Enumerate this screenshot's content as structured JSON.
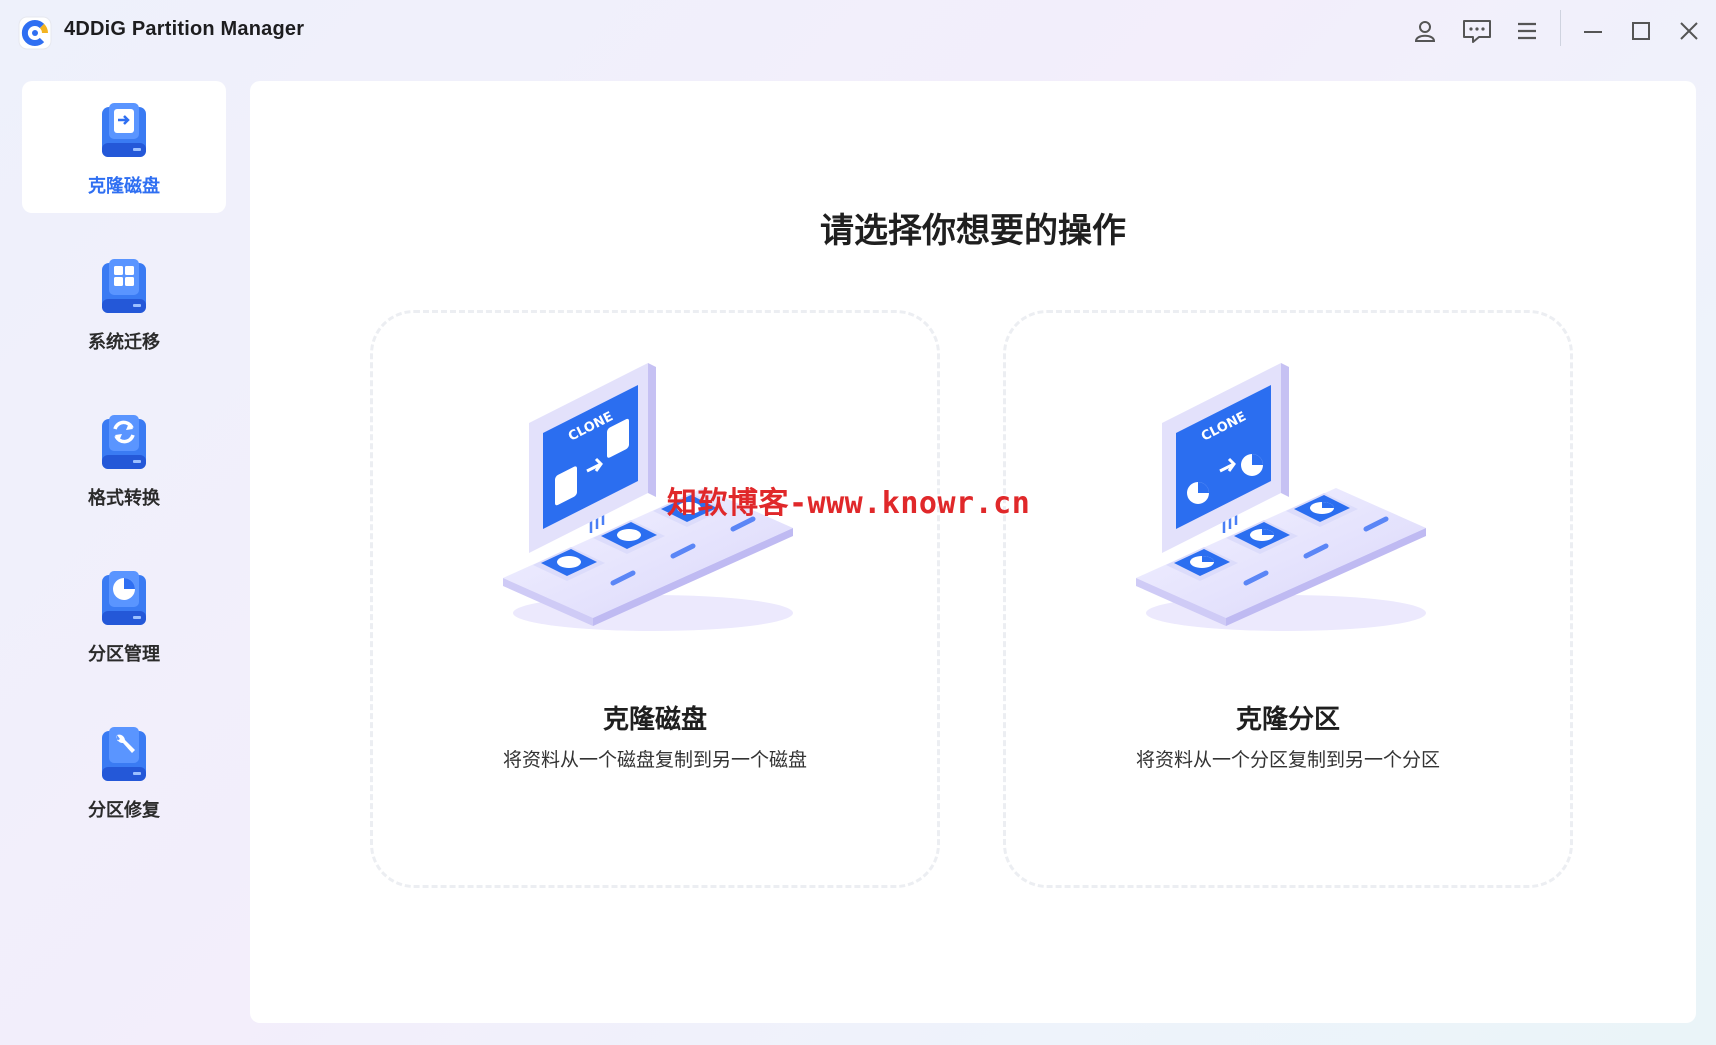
{
  "app": {
    "title": "4DDiG Partition Manager",
    "logo_icon": "4ddig-logo-icon"
  },
  "titlebar": {
    "buttons": [
      {
        "name": "account-icon"
      },
      {
        "name": "feedback-icon"
      },
      {
        "name": "menu-icon"
      },
      {
        "name": "minimize-icon"
      },
      {
        "name": "maximize-icon"
      },
      {
        "name": "close-icon"
      }
    ]
  },
  "sidebar": {
    "items": [
      {
        "label": "克隆磁盘",
        "icon": "clone-disk-icon",
        "active": true
      },
      {
        "label": "系统迁移",
        "icon": "system-migrate-icon",
        "active": false
      },
      {
        "label": "格式转换",
        "icon": "format-convert-icon",
        "active": false
      },
      {
        "label": "分区管理",
        "icon": "partition-manage-icon",
        "active": false
      },
      {
        "label": "分区修复",
        "icon": "partition-repair-icon",
        "active": false
      }
    ]
  },
  "main": {
    "title": "请选择你想要的操作",
    "cards": [
      {
        "title": "克隆磁盘",
        "desc": "将资料从一个磁盘复制到另一个磁盘",
        "illus_text": "CLONE"
      },
      {
        "title": "克隆分区",
        "desc": "将资料从一个分区复制到另一个分区",
        "illus_text": "CLONE"
      }
    ]
  },
  "watermark": "知软博客-www.knowr.cn",
  "colors": {
    "accent": "#2f6ff2",
    "illus_blue": "#2b6ef0",
    "panel": "#ffffff"
  }
}
